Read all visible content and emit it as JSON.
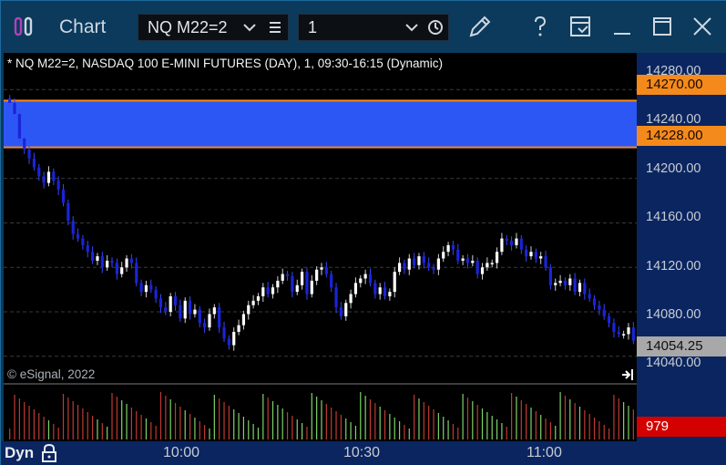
{
  "window": {
    "app_title": "Chart",
    "icons": [
      "app-icon",
      "chevron-down-icon",
      "menu-icon",
      "clock-icon",
      "pencil-icon",
      "help-icon",
      "window-link-icon",
      "minimize-icon",
      "maximize-icon",
      "close-icon"
    ]
  },
  "toolbar": {
    "symbol": "NQ M22=2",
    "interval": "1"
  },
  "chart": {
    "title": "* NQ M22=2, NASDAQ 100 E-MINI FUTURES (DAY), 1, 09:30-16:15 (Dynamic)",
    "copyright": "© eSignal, 2022",
    "time_mode": "Dyn",
    "price_levels": [
      "14280.00",
      "14240.00",
      "14200.00",
      "14160.00",
      "14120.00",
      "14080.00",
      "14040.00"
    ],
    "time_labels": [
      "10:00",
      "10:30",
      "11:00"
    ],
    "zone_upper": "14270.00",
    "zone_lower": "14228.00",
    "last_price": "14054.25",
    "last_volume": "979",
    "colors": {
      "background": "#000000",
      "up_candle": "#ffffff",
      "down_candle": "#1a24d8",
      "zone_fill": "#2d57f5",
      "zone_border": "#f48a1c",
      "zone_tag": "#f48a1c",
      "last_price_tag": "#a8a8a8",
      "volume_tag": "#d40000",
      "volume_up": "#7ed36a",
      "volume_down": "#c03a32",
      "axis_bg": "#0a2560"
    }
  },
  "chart_data": {
    "type": "candlestick",
    "title": "* NQ M22=2, NASDAQ 100 E-MINI FUTURES (DAY), 1, 09:30-16:15 (Dynamic)",
    "xlabel": "",
    "ylabel": "",
    "ylim": [
      14030,
      14290
    ],
    "y_ticks": [
      14040,
      14080,
      14120,
      14160,
      14200,
      14240,
      14280
    ],
    "x_ticks": [
      "10:00",
      "10:30",
      "11:00"
    ],
    "highlight_zone": [
      14228,
      14270
    ],
    "grid": true,
    "closes": [
      14268,
      14258,
      14236,
      14226,
      14218,
      14210,
      14202,
      14196,
      14206,
      14198,
      14190,
      14178,
      14162,
      14150,
      14146,
      14140,
      14134,
      14126,
      14130,
      14120,
      14126,
      14124,
      14114,
      14120,
      14128,
      14124,
      14106,
      14098,
      14104,
      14100,
      14092,
      14084,
      14080,
      14094,
      14086,
      14074,
      14090,
      14078,
      14082,
      14070,
      14066,
      14078,
      14084,
      14066,
      14056,
      14050,
      14062,
      14068,
      14078,
      14086,
      14090,
      14094,
      14102,
      14096,
      14102,
      14108,
      14114,
      14112,
      14098,
      14104,
      14116,
      14096,
      14108,
      14118,
      14120,
      14114,
      14102,
      14084,
      14076,
      14088,
      14096,
      14106,
      14110,
      14114,
      14106,
      14096,
      14102,
      14094,
      14098,
      14116,
      14124,
      14118,
      14128,
      14122,
      14130,
      14124,
      14120,
      14118,
      14128,
      14134,
      14140,
      14136,
      14126,
      14128,
      14124,
      14126,
      14114,
      14120,
      14124,
      14124,
      14134,
      14146,
      14144,
      14140,
      14146,
      14136,
      14130,
      14134,
      14128,
      14130,
      14120,
      14104,
      14106,
      14108,
      14104,
      14110,
      14098,
      14106,
      14096,
      14092,
      14086,
      14082,
      14076,
      14070,
      14062,
      14060,
      14060,
      14066,
      14054
    ],
    "volume_last": 979
  }
}
